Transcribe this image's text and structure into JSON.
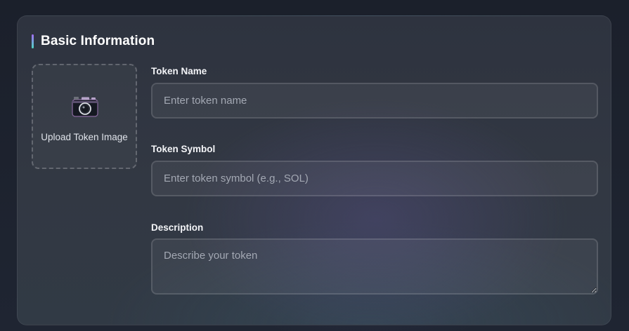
{
  "section": {
    "title": "Basic Information"
  },
  "upload": {
    "label": "Upload Token Image",
    "icon": "camera-icon"
  },
  "fields": {
    "token_name": {
      "label": "Token Name",
      "value": "",
      "placeholder": "Enter token name"
    },
    "token_symbol": {
      "label": "Token Symbol",
      "value": "",
      "placeholder": "Enter token symbol (e.g., SOL)"
    },
    "description": {
      "label": "Description",
      "value": "",
      "placeholder": "Describe your token"
    }
  },
  "colors": {
    "page_background": "#1c212d",
    "card_background": "#313743",
    "title_accent_top": "#a46cf5",
    "title_accent_bottom": "#4ed7c2",
    "text_primary": "#ffffff",
    "placeholder": "#a3a8b3"
  }
}
